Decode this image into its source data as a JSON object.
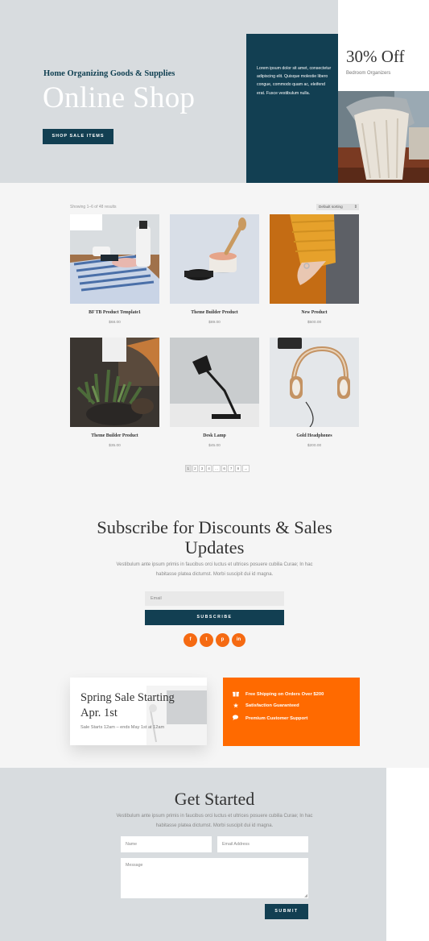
{
  "hero": {
    "subtitle": "Home Organizing Goods & Supplies",
    "title": "Online Shop",
    "button_label": "SHOP SALE ITEMS",
    "panel_text": "Lorem ipsum dolor sit amet, consectetur adipiscing elit. Quisque molestie libero congue, commodo quam ac, eleifend erat. Fusce vestibulum nulla.",
    "offer_title": "30% Off",
    "offer_subtitle": "Bedroom Organizers"
  },
  "shop": {
    "results_count": "Showing 1–6 of 48 results",
    "sort_label": "Default sorting",
    "products": [
      {
        "name": "BF TB Product Template1",
        "price": "$68.00"
      },
      {
        "name": "Theme Builder Product",
        "price": "$89.00"
      },
      {
        "name": "New Product",
        "price": "$500.00"
      },
      {
        "name": "Theme Builder Product",
        "price": "$35.00"
      },
      {
        "name": "Desk Lamp",
        "price": "$45.00"
      },
      {
        "name": "Gold Headphones",
        "price": "$200.00"
      }
    ],
    "pagination": [
      "1",
      "2",
      "3",
      "4",
      "…",
      "6",
      "7",
      "8",
      "→"
    ]
  },
  "subscribe": {
    "title": "Subscribe for Discounts & Sales Updates",
    "text": "Vestibulum ante ipsum primis in faucibus orci luctus et ultrices posuere cubilia Curae; In hac habitasse platea dictumst. Morbi suscipit dui id magna.",
    "email_placeholder": "Email",
    "button_label": "SUBSCRIBE",
    "social": [
      "f",
      "t",
      "p",
      "in"
    ]
  },
  "promo": {
    "title": "Spring Sale Starting Apr. 1st",
    "subtitle": "Sale Starts 12am – ends May 1st at 12am",
    "features": [
      {
        "icon": "gift-icon",
        "label": "Free Shipping on Orders Over $200"
      },
      {
        "icon": "star-icon",
        "label": "Satisfaction Guaranteed"
      },
      {
        "icon": "chat-icon",
        "label": "Premium Customer Support"
      }
    ]
  },
  "get_started": {
    "title": "Get Started",
    "text": "Vestibulum ante ipsum primis in faucibus orci luctus et ultrices posuere cubilia Curae; In hac habitasse platea dictumst. Morbi suscipit dui id magna.",
    "name_placeholder": "Name",
    "email_placeholder": "Email Address",
    "message_placeholder": "Message",
    "button_label": "SUBMIT"
  },
  "colors": {
    "navy": "#123f52",
    "orange": "#ff6a00",
    "hero_bg": "#d8dcdf"
  }
}
